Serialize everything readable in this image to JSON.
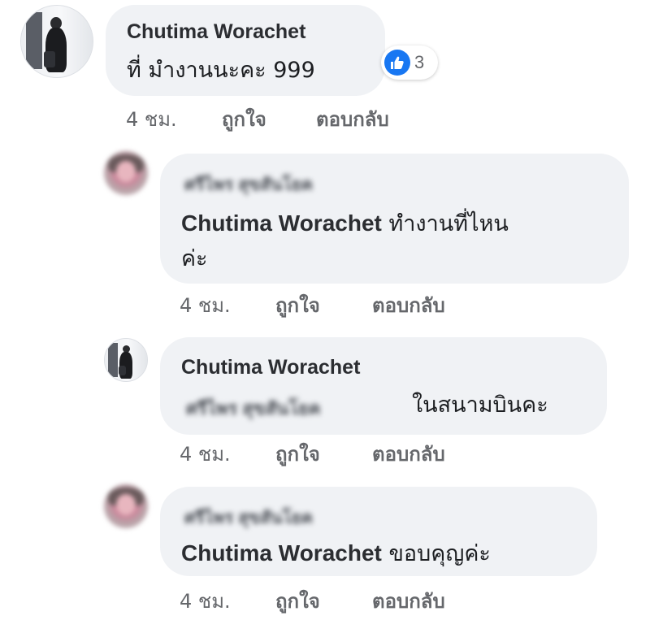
{
  "colors": {
    "bubble_bg": "#f0f2f5",
    "author_text": "#2b2d31",
    "meta_text": "#65676b",
    "like_blue": "#1877f2"
  },
  "comments": [
    {
      "author": "Chutima Worachet",
      "text": "ที่ มำงานนะคะ  999",
      "reaction": {
        "icon": "like-icon",
        "count": "3"
      },
      "time": "4 ชม.",
      "like_label": "ถูกใจ",
      "reply_label": "ตอบกลับ"
    },
    {
      "author": "ศรีไพร สุขสันโยค",
      "mention": "Chutima Worachet",
      "text_line1": " ทำงานที่ไหน",
      "text_line2": "ค่ะ",
      "time": "4 ชม.",
      "like_label": "ถูกใจ",
      "reply_label": "ตอบกลับ"
    },
    {
      "author": "Chutima Worachet",
      "mention": "ศรีไพร สุขสันโยค",
      "text": "ในสนามบินคะ",
      "time": "4 ชม.",
      "like_label": "ถูกใจ",
      "reply_label": "ตอบกลับ"
    },
    {
      "author": "ศรีไพร สุขสันโยค",
      "mention": "Chutima Worachet",
      "text": "  ขอบคุญค่ะ",
      "time": "4 ชม.",
      "like_label": "ถูกใจ",
      "reply_label": "ตอบกลับ"
    }
  ]
}
